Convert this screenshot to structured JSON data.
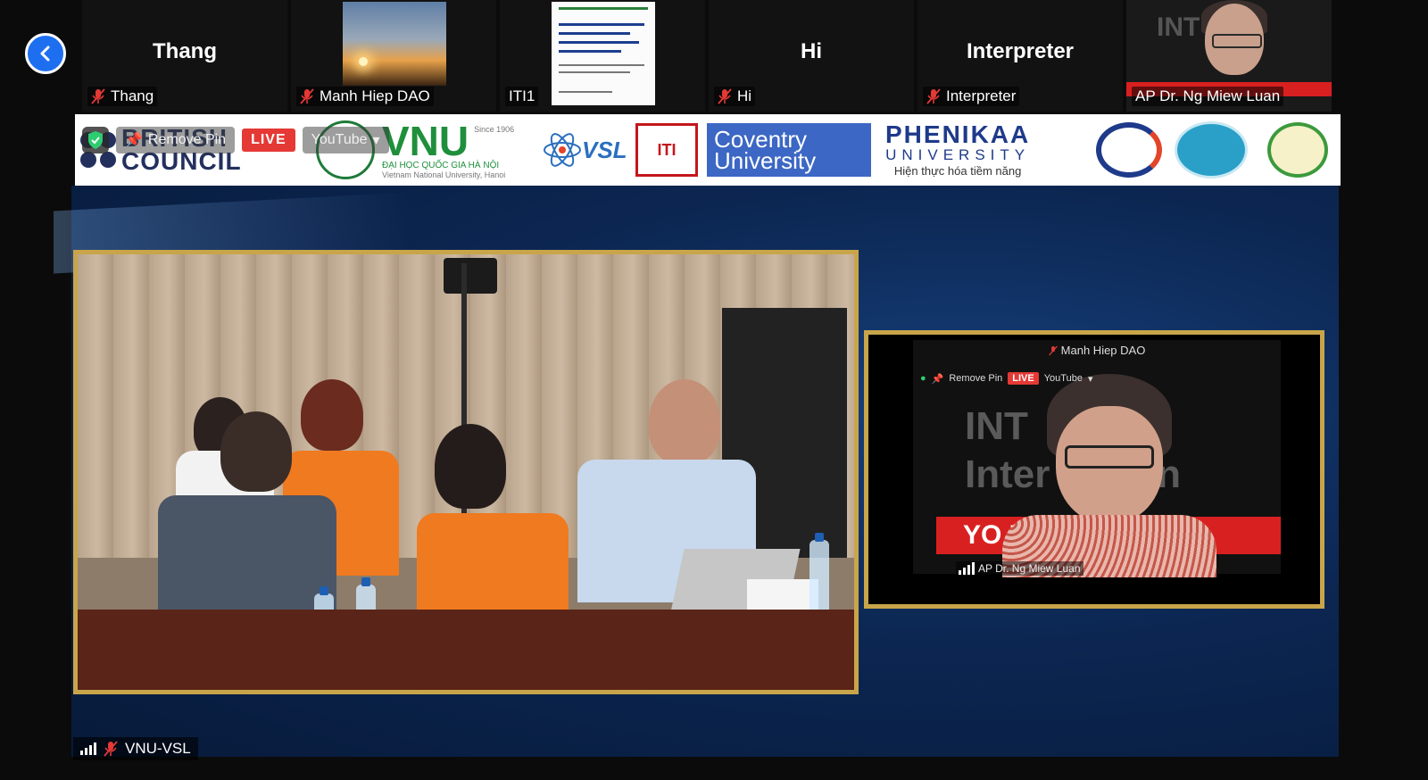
{
  "nav": {
    "back_icon": "chevron-left-icon"
  },
  "participants": [
    {
      "display_name": "Thang",
      "label": "Thang",
      "muted": true
    },
    {
      "display_name": "",
      "label": "Manh Hiep DAO",
      "muted": true
    },
    {
      "display_name": "",
      "label": "ITI1",
      "muted": false
    },
    {
      "display_name": "Hi",
      "label": "Hi",
      "muted": true
    },
    {
      "display_name": "Interpreter",
      "label": "Interpreter",
      "muted": true
    },
    {
      "display_name": "",
      "label": "AP Dr. Ng Miew Luan",
      "muted": false
    }
  ],
  "speaker_thumb": {
    "bg_text": "INT"
  },
  "banner": {
    "british_council": "BRITISH COUNCIL",
    "vnu": "VNU",
    "vnu_since": "Since 1906",
    "vnu_vn": "ĐẠI HỌC QUỐC GIA HÀ NỘI",
    "vnu_en": "Vietnam National University, Hanoi",
    "vsl": "VSL",
    "iti": "ITI",
    "coventry_1": "Coventry",
    "coventry_2": "University",
    "phenikaa_1": "PHENIKAA",
    "phenikaa_2": "UNIVERSITY",
    "phenikaa_3": "Hiện thực hóa tiềm năng"
  },
  "stream_controls": {
    "remove_pin": "Remove Pin",
    "live": "LIVE",
    "youtube": "YouTube"
  },
  "side_video": {
    "top_name": "Manh Hiep DAO",
    "remove_pin": "Remove Pin",
    "live": "LIVE",
    "youtube": "YouTube",
    "bg_line1": "INT",
    "bg_line2": "Inter    hal Un",
    "red_text": "YO              ILT T",
    "label": "AP Dr. Ng Miew Luan"
  },
  "main_video": {
    "label": "VNU-VSL"
  },
  "colors": {
    "accent": "#1e6ff0",
    "frame": "#c9a54a",
    "live": "#e53935",
    "muted": "#e53935"
  }
}
